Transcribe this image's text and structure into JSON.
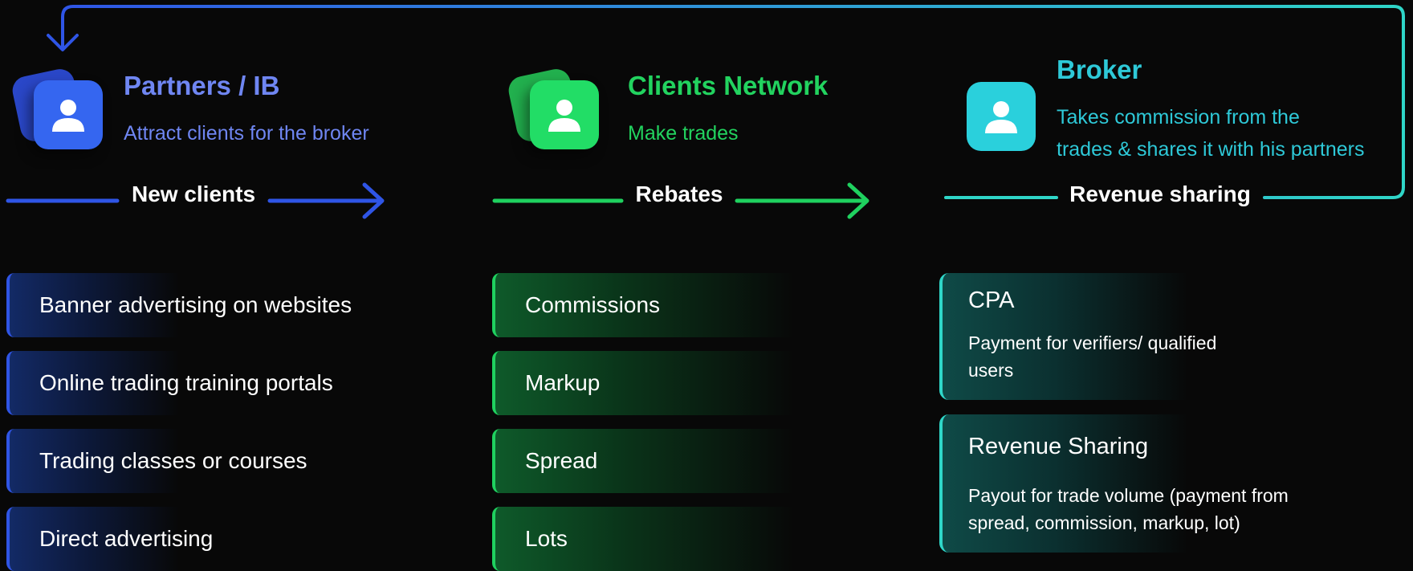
{
  "colors": {
    "blue": "#2f55e6",
    "blue_text": "#6f86f2",
    "green": "#1fd15f",
    "green_text": "#22d35f",
    "teal": "#2fd6c8",
    "teal_text": "#2ec9d8",
    "background": "#080808"
  },
  "partners": {
    "title": "Partners / IB",
    "subtitle": "Attract clients for the broker",
    "icon": "user-icon",
    "arrow_label": "New clients",
    "items": [
      "Banner advertising on websites",
      "Online trading training portals",
      "Trading classes or courses",
      "Direct advertising"
    ]
  },
  "clients": {
    "title": "Clients Network",
    "subtitle": "Make trades",
    "icon": "user-icon",
    "arrow_label": "Rebates",
    "items": [
      "Commissions",
      "Markup",
      "Spread",
      "Lots"
    ]
  },
  "broker": {
    "title": "Broker",
    "subtitle_line1": "Takes commission from the",
    "subtitle_line2": "trades & shares it with his partners",
    "icon": "user-icon",
    "arrow_label": "Revenue sharing",
    "cards": [
      {
        "title": "CPA",
        "desc_line1": "Payment for verifiers/ qualified",
        "desc_line2": "users"
      },
      {
        "title": "Revenue Sharing",
        "desc_line1": "Payout for trade volume (payment from",
        "desc_line2": "spread, commission, markup, lot)"
      }
    ]
  }
}
